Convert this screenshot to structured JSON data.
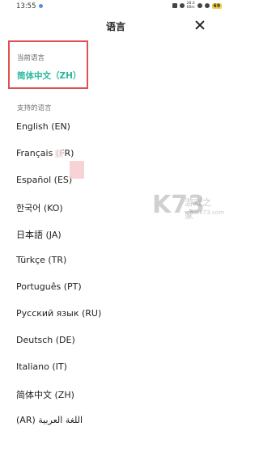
{
  "status": {
    "time": "13:55",
    "speed_top": "28.0",
    "speed_bottom": "KB/s",
    "battery": "69"
  },
  "header": {
    "title": "语言"
  },
  "current": {
    "label": "当前语言",
    "value": "简体中文（ZH）"
  },
  "supported": {
    "label": "支持的语言",
    "items": [
      "English (EN)",
      "Français (FR)",
      "Español (ES)",
      "한국어 (KO)",
      "日本語 (JA)",
      "Türkçe (TR)",
      "Português (PT)",
      "Русский язык (RU)",
      "Deutsch (DE)",
      "Italiano (IT)",
      "简体中文 (ZH)",
      "(AR) اللغة العربية"
    ]
  },
  "watermark": {
    "logo": "K73",
    "text": "游戏之家",
    "url": "www.k73.com"
  },
  "colors": {
    "accent": "#27b89e",
    "highlight_box": "#e05050"
  }
}
